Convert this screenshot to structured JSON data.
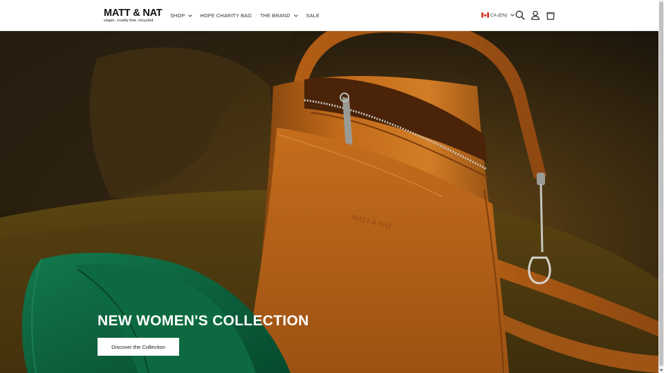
{
  "header": {
    "logo": {
      "name": "MATT & NAT",
      "tagline": "vegan. cruelty free. recycled."
    },
    "nav": [
      {
        "label": "SHOP",
        "has_dropdown": true
      },
      {
        "label": "HOPE CHARITY BAG",
        "has_dropdown": false
      },
      {
        "label": "THE BRAND",
        "has_dropdown": true
      },
      {
        "label": "SALE",
        "has_dropdown": false
      }
    ],
    "locale": {
      "label": "CA (EN)",
      "flag_icon": "canada-flag-icon"
    },
    "icons": [
      "search-icon",
      "account-icon",
      "cart-icon"
    ]
  },
  "hero": {
    "title": "NEW WOMEN'S COLLECTION",
    "cta_label": "Discover the Collection",
    "image_subject": "orange-handbag-and-green-wallet-photo"
  },
  "colors": {
    "header_bg": "#ffffff",
    "text": "#333333",
    "hero_text": "#ffffff",
    "bag": "#c86f1c",
    "wallet": "#0f6e47",
    "background_dark": "#2a1d0c"
  }
}
